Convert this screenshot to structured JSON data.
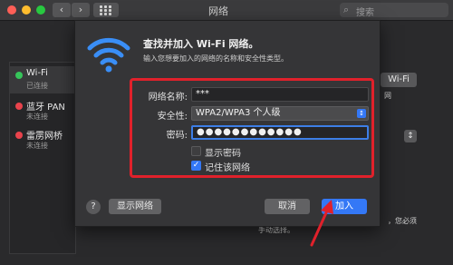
{
  "window": {
    "title": "网络",
    "search_placeholder": "搜索"
  },
  "sidebar": {
    "items": [
      {
        "name": "Wi-Fi",
        "status": "已连接",
        "status_color": "#36c45a"
      },
      {
        "name": "蓝牙 PAN",
        "status": "未连接",
        "status_color": "#e8434c"
      },
      {
        "name": "雷雳网桥",
        "status": "未连接",
        "status_color": "#e8434c"
      }
    ]
  },
  "background": {
    "wifi_button": "Wi-Fi",
    "fragment_u": "网",
    "note_line1": "，您必须",
    "note_line2": "手动选择。"
  },
  "dialog": {
    "title": "查找并加入 Wi-Fi 网络。",
    "subtitle": "输入您想要加入的网络的名称和安全性类型。",
    "network_name_label": "网络名称:",
    "network_name_value": "***",
    "security_label": "安全性:",
    "security_value": "WPA2/WPA3 个人级",
    "password_label": "密码:",
    "password_value": "●●●●●●●●●●●●",
    "show_password_label": "显示密码",
    "show_password_checked": false,
    "remember_label": "记住该网络",
    "remember_checked": true,
    "help": "?",
    "show_networks_button": "显示网络",
    "cancel_button": "取消",
    "join_button": "加入"
  },
  "colors": {
    "accent": "#3478f6",
    "highlight_box": "#e0212b"
  }
}
